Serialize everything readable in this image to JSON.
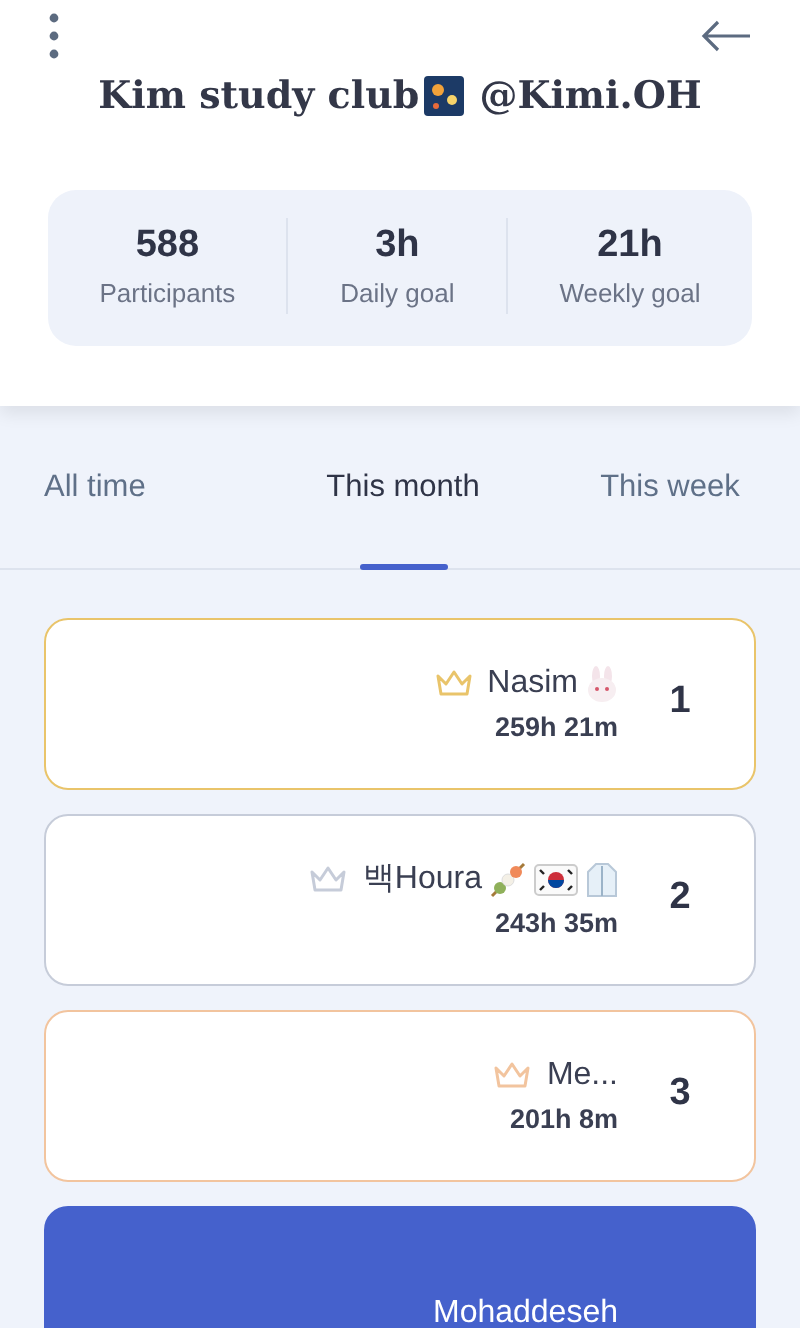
{
  "header": {
    "title": "Kim study club",
    "subtitle": "@Kimi.OH"
  },
  "stats": [
    {
      "value": "588",
      "label": "Participants"
    },
    {
      "value": "3h",
      "label": "Daily goal"
    },
    {
      "value": "21h",
      "label": "Weekly goal"
    }
  ],
  "tabs": [
    {
      "label": "All time",
      "selected": false
    },
    {
      "label": "This month",
      "selected": true
    },
    {
      "label": "This week",
      "selected": false
    }
  ],
  "leaderboard": [
    {
      "rank": "1",
      "name": "Nasim",
      "time": "259h 21m",
      "color": "#e9c46a",
      "highlighted": false
    },
    {
      "rank": "2",
      "name": "백Houra",
      "time": "243h 35m",
      "color": "#c6ccd9",
      "highlighted": false
    },
    {
      "rank": "3",
      "name": "Me...",
      "time": "201h 8m",
      "color": "#f2c49e",
      "highlighted": false
    },
    {
      "name": "Mohaddeseh",
      "color": "#4561cc",
      "highlighted": true
    }
  ]
}
